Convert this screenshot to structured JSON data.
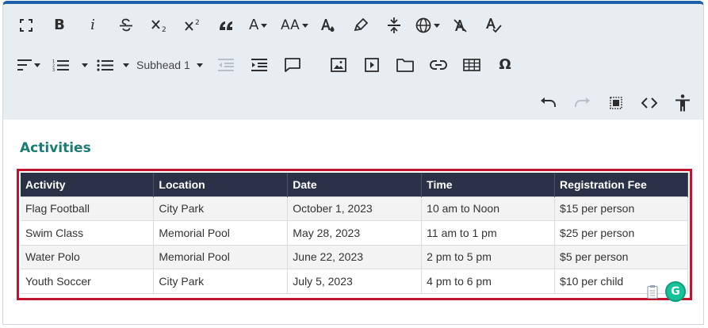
{
  "toolbar": {
    "row1": [
      {
        "name": "fullscreen-icon"
      },
      {
        "name": "bold-icon",
        "glyph": "B"
      },
      {
        "name": "italic-icon",
        "glyph": "i"
      },
      {
        "name": "strikethrough-icon"
      },
      {
        "name": "subscript-icon"
      },
      {
        "name": "superscript-icon"
      },
      {
        "name": "quote-icon",
        "glyph": "“"
      },
      {
        "name": "font-color-icon",
        "glyph": "A"
      },
      {
        "name": "font-size-icon",
        "glyph": "AA"
      },
      {
        "name": "text-color-icon",
        "glyph": "A"
      },
      {
        "name": "highlighter-icon"
      },
      {
        "name": "line-height-icon"
      },
      {
        "name": "language-icon"
      },
      {
        "name": "clear-format-icon",
        "glyph": "A"
      },
      {
        "name": "spellcheck-icon",
        "glyph": "A"
      }
    ],
    "subhead_label": "Subhead 1",
    "omega_glyph": "Ω"
  },
  "content": {
    "heading": "Activities",
    "table": {
      "headers": [
        "Activity",
        "Location",
        "Date",
        "Time",
        "Registration Fee"
      ],
      "rows": [
        [
          "Flag Football",
          "City Park",
          "October 1, 2023",
          "10 am to Noon",
          "$15 per person"
        ],
        [
          "Swim Class",
          "Memorial Pool",
          "May 28, 2023",
          "11 am to 1 pm",
          "$25 per person"
        ],
        [
          "Water Polo",
          "Memorial Pool",
          "June 22, 2023",
          "2 pm to 5 pm",
          "$5 per person"
        ],
        [
          "Youth Soccer",
          "City Park",
          "July 5, 2023",
          "4 pm to 6 pm",
          "$10 per child"
        ]
      ]
    }
  },
  "grammarly_glyph": "G",
  "colors": {
    "toolbar_bg": "#e8edf2",
    "accent_top": "#1d5fa8",
    "heading": "#1b7c74",
    "table_header_bg": "#2b3147",
    "selection_border": "#c2132f",
    "grammarly": "#15c39a"
  }
}
